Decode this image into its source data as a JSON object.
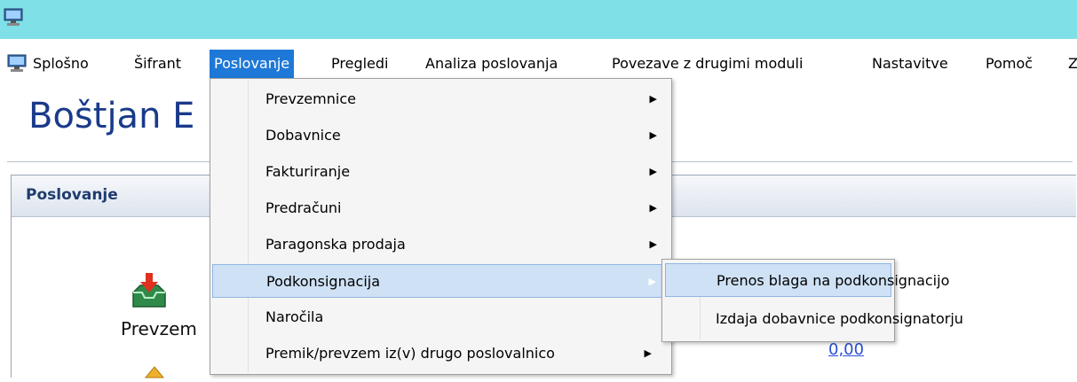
{
  "colors": {
    "titlebar": "#7fe0e8",
    "menu_active": "#1e78d7",
    "highlight": "#cfe1f5",
    "brand_text": "#1a3a8a"
  },
  "titlebar": {
    "icon": "computer-icon"
  },
  "menubar": {
    "icon": "computer-icon",
    "items": [
      "Splošno",
      "Šifrant",
      "Poslovanje",
      "Pregledi",
      "Analiza poslovanja",
      "Povezave z drugimi moduli",
      "Nastavitve",
      "Pomoč",
      "Z"
    ],
    "active_index": 2
  },
  "header": {
    "name": "Boštjan E"
  },
  "panel": {
    "title": "Poslovanje",
    "tile_label": "Prevzem",
    "link_value": "0,00"
  },
  "dropdown": {
    "items": [
      {
        "label": "Prevzemnice",
        "submenu": true
      },
      {
        "label": "Dobavnice",
        "submenu": true
      },
      {
        "label": "Fakturiranje",
        "submenu": true
      },
      {
        "label": "Predračuni",
        "submenu": true
      },
      {
        "label": "Paragonska prodaja",
        "submenu": true
      },
      {
        "label": "Podkonsignacija",
        "submenu": true,
        "highlighted": true
      },
      {
        "label": "Naročila",
        "submenu": false
      },
      {
        "label": "Premik/prevzem iz(v) drugo poslovalnico",
        "submenu": true
      }
    ]
  },
  "submenu": {
    "items": [
      {
        "label": "Prenos blaga na podkonsignacijo",
        "highlighted": true
      },
      {
        "label": "Izdaja dobavnice podkonsignatorju"
      }
    ]
  }
}
